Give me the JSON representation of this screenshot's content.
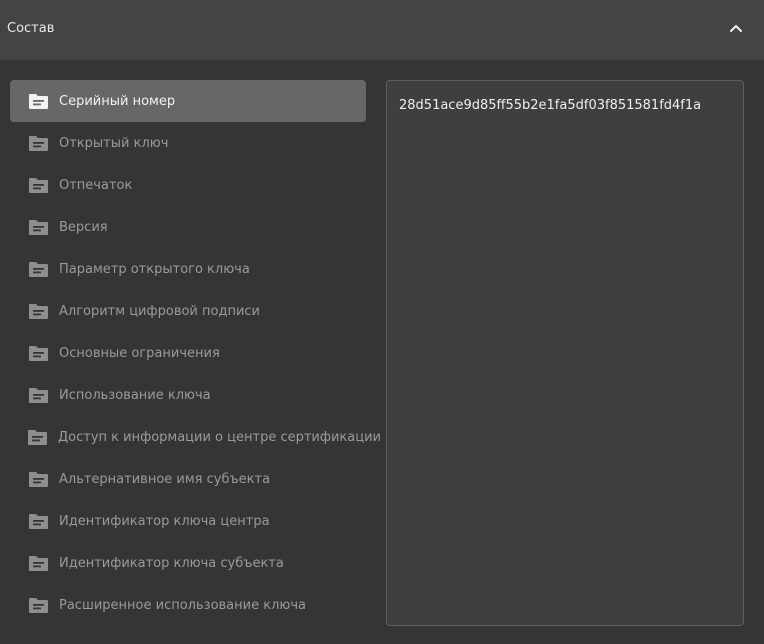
{
  "header": {
    "title": "Состав"
  },
  "list": {
    "items": [
      {
        "label": "Серийный номер",
        "selected": true
      },
      {
        "label": "Открытый ключ",
        "selected": false
      },
      {
        "label": "Отпечаток",
        "selected": false
      },
      {
        "label": "Версия",
        "selected": false
      },
      {
        "label": "Параметр открытого ключа",
        "selected": false
      },
      {
        "label": "Алгоритм цифровой подписи",
        "selected": false
      },
      {
        "label": "Основные ограничения",
        "selected": false
      },
      {
        "label": "Использование ключа",
        "selected": false
      },
      {
        "label": "Доступ к информации о центре сертификации",
        "selected": false
      },
      {
        "label": "Альтернативное имя субъекта",
        "selected": false
      },
      {
        "label": "Идентификатор ключа центра",
        "selected": false
      },
      {
        "label": "Идентификатор ключа субъекта",
        "selected": false
      },
      {
        "label": "Расширенное использование ключа",
        "selected": false
      }
    ]
  },
  "detail": {
    "value": "28d51ace9d85ff55b2e1fa5df03f851581fd4f1a"
  },
  "colors": {
    "selected_bg": "#676767",
    "icon_active": "#f2f2f2",
    "icon_inactive": "#8e8e8e"
  },
  "icons": {
    "collapse": "chevron-up-icon",
    "item": "document-folder-icon"
  }
}
